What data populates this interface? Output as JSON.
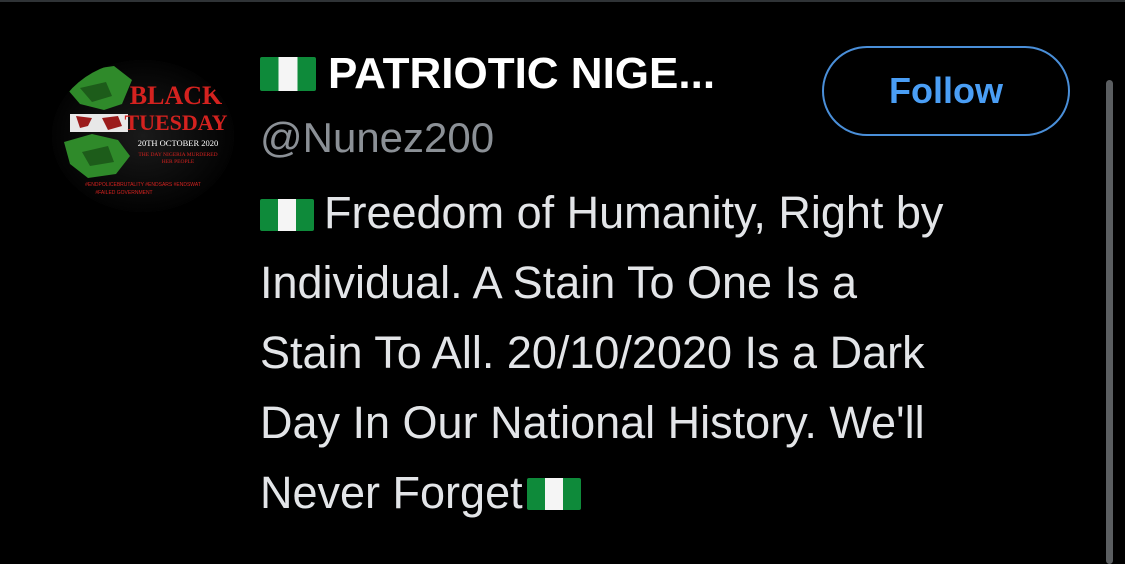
{
  "user": {
    "display_name": "PATRIOTIC NIGE...",
    "handle": "@Nunez200",
    "follow_label": "Follow",
    "bio_lines": [
      "Freedom of Humanity, Right by",
      "Individual. A Stain To One Is a",
      "Stain To All. 20/10/2020 Is a Dark",
      "Day In Our National History. We'll",
      "Never Forget"
    ]
  },
  "avatar": {
    "title": "BLACK",
    "title2": "TUESDAY",
    "date": "20TH OCTOBER 2020",
    "caption1": "THE DAY NIGERIA MURDERED",
    "caption2": "HER PEOPLE",
    "hashtags1": "#ENDPOLICEBRUTALITY #ENDSARS #ENDSWAT",
    "hashtags2": "#FAILED GOVERNMENT"
  },
  "icons": {
    "flag": "nigeria-flag-icon"
  },
  "colors": {
    "background": "#000000",
    "accent": "#4a9ef5",
    "handle": "#8b9096",
    "flag_green": "#0e8a3a"
  }
}
